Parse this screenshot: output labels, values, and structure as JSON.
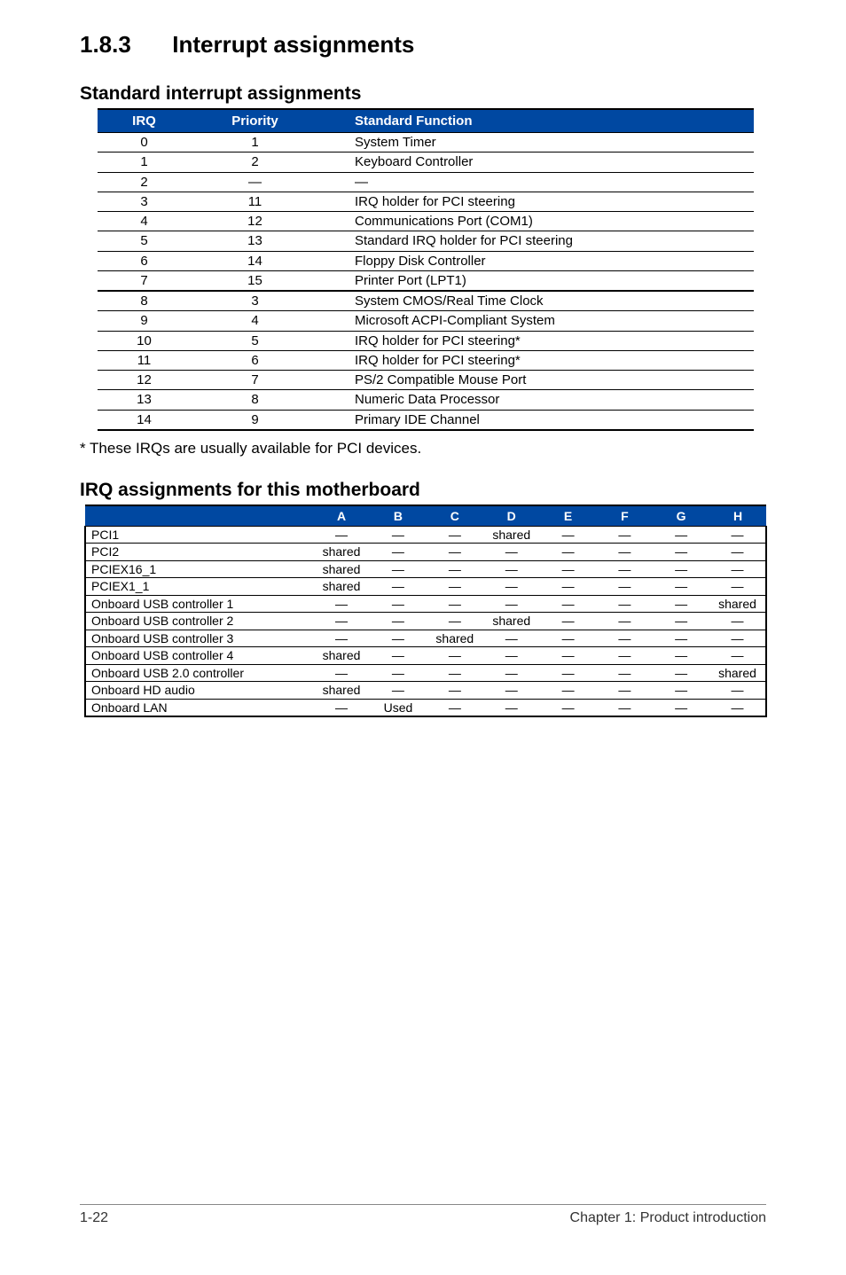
{
  "section": {
    "no": "1.8.3",
    "title": "Interrupt assignments"
  },
  "sub1": "Standard interrupt assignments",
  "t1head": {
    "c1": "IRQ",
    "c2": "Priority",
    "c3": "Standard Function"
  },
  "t1rows": [
    {
      "a": "0",
      "b": "1",
      "c": "System Timer"
    },
    {
      "a": "1",
      "b": "2",
      "c": "Keyboard Controller"
    },
    {
      "a": "2",
      "b": "—",
      "c": "—"
    },
    {
      "a": "3",
      "b": "11",
      "c": "IRQ holder for PCI steering"
    },
    {
      "a": "4",
      "b": "12",
      "c": "Communications Port (COM1)"
    },
    {
      "a": "5",
      "b": "13",
      "c": "Standard IRQ holder for PCI steering"
    },
    {
      "a": "6",
      "b": "14",
      "c": "Floppy Disk Controller"
    },
    {
      "a": "7",
      "b": "15",
      "c": "Printer Port (LPT1)"
    },
    {
      "a": "8",
      "b": "3",
      "c": "System CMOS/Real Time Clock"
    },
    {
      "a": "9",
      "b": "4",
      "c": "Microsoft ACPI-Compliant System"
    },
    {
      "a": "10",
      "b": "5",
      "c": "IRQ holder for PCI steering*"
    },
    {
      "a": "11",
      "b": "6",
      "c": "IRQ holder for PCI steering*"
    },
    {
      "a": "12",
      "b": "7",
      "c": "PS/2 Compatible Mouse Port"
    },
    {
      "a": "13",
      "b": "8",
      "c": "Numeric Data Processor"
    },
    {
      "a": "14",
      "b": "9",
      "c": "Primary IDE Channel"
    }
  ],
  "note": "* These IRQs are usually available for PCI devices.",
  "sub2": "IRQ assignments for this motherboard",
  "t2head": {
    "c0": "",
    "cA": "A",
    "cB": "B",
    "cC": "C",
    "cD": "D",
    "cE": "E",
    "cF": "F",
    "cG": "G",
    "cH": "H"
  },
  "t2rows": [
    {
      "n": "PCI1",
      "A": "—",
      "B": "—",
      "C": "—",
      "D": "shared",
      "E": "—",
      "F": "—",
      "G": "—",
      "H": "—"
    },
    {
      "n": "PCI2",
      "A": "shared",
      "B": "—",
      "C": "—",
      "D": "—",
      "E": "—",
      "F": "—",
      "G": "—",
      "H": "—"
    },
    {
      "n": "PCIEX16_1",
      "A": "shared",
      "B": "—",
      "C": "—",
      "D": "—",
      "E": "—",
      "F": "—",
      "G": "—",
      "H": "—"
    },
    {
      "n": "PCIEX1_1",
      "A": "shared",
      "B": "—",
      "C": "—",
      "D": "—",
      "E": "—",
      "F": "—",
      "G": "—",
      "H": "—"
    },
    {
      "n": "Onboard USB controller 1",
      "A": "—",
      "B": "—",
      "C": "—",
      "D": "—",
      "E": "—",
      "F": "—",
      "G": "—",
      "H": "shared"
    },
    {
      "n": "Onboard USB controller 2",
      "A": "—",
      "B": "—",
      "C": "—",
      "D": "shared",
      "E": "—",
      "F": "—",
      "G": "—",
      "H": "—"
    },
    {
      "n": "Onboard USB controller 3",
      "A": "—",
      "B": "—",
      "C": "shared",
      "D": "—",
      "E": "—",
      "F": "—",
      "G": "—",
      "H": "—"
    },
    {
      "n": "Onboard USB controller 4",
      "A": "shared",
      "B": "—",
      "C": "—",
      "D": "—",
      "E": "—",
      "F": "—",
      "G": "—",
      "H": "—"
    },
    {
      "n": "Onboard USB 2.0 controller",
      "A": "—",
      "B": "—",
      "C": "—",
      "D": "—",
      "E": "—",
      "F": "—",
      "G": "—",
      "H": "shared"
    },
    {
      "n": "Onboard HD audio",
      "A": "shared",
      "B": "—",
      "C": "—",
      "D": "—",
      "E": "—",
      "F": "—",
      "G": "—",
      "H": "—"
    },
    {
      "n": "Onboard LAN",
      "A": "—",
      "B": "Used",
      "C": "—",
      "D": "—",
      "E": "—",
      "F": "—",
      "G": "—",
      "H": "—"
    }
  ],
  "footer": {
    "page": "1-22",
    "chapter": "Chapter 1: Product introduction"
  }
}
